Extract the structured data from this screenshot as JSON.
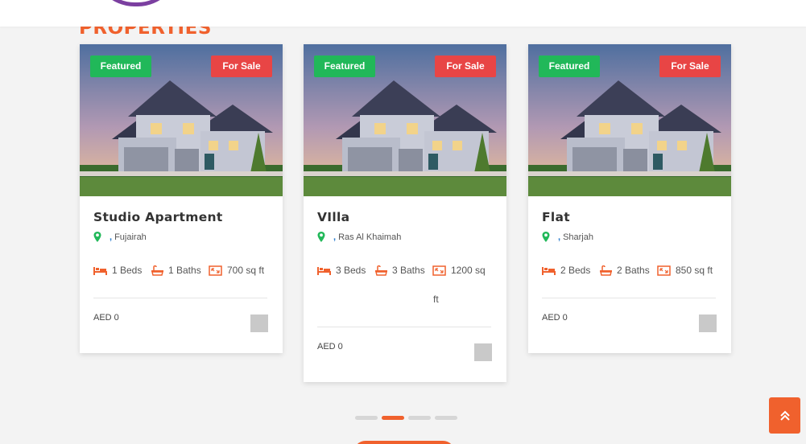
{
  "header": {
    "section_title": "PROPERTIES"
  },
  "colors": {
    "accent": "#f0612d",
    "featured": "#21b859",
    "for_sale": "#e84545",
    "location_pin": "#21b859"
  },
  "cards": [
    {
      "badge_featured": "Featured",
      "badge_status": "For Sale",
      "title": "Studio Apartment",
      "location": "Fujairah",
      "beds": "1 Beds",
      "baths": "1 Baths",
      "area": "700 sq ft",
      "price": "AED 0"
    },
    {
      "badge_featured": "Featured",
      "badge_status": "For Sale",
      "title": "VIlla",
      "location": "Ras Al Khaimah",
      "beds": "3 Beds",
      "baths": "3 Baths",
      "area_line1": "1200 sq",
      "area_line2": "ft",
      "price": "AED 0"
    },
    {
      "badge_featured": "Featured",
      "badge_status": "For Sale",
      "title": "Flat",
      "location": "Sharjah",
      "beds": "2 Beds",
      "baths": "2 Baths",
      "area": "850 sq ft",
      "price": "AED 0"
    }
  ],
  "carousel": {
    "total_dots": 4,
    "active_dot": 2
  },
  "icons": {
    "location": "map-marker-icon",
    "beds": "bed-icon",
    "baths": "bathtub-icon",
    "area": "area-icon",
    "scroll_top": "double-chevron-up-icon"
  }
}
